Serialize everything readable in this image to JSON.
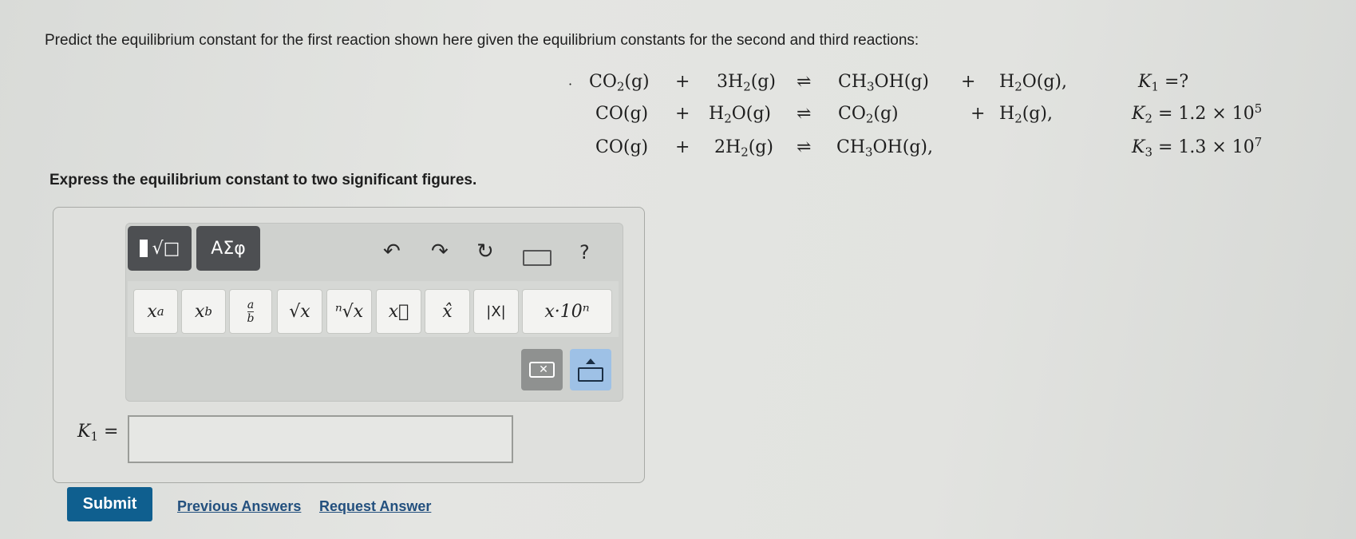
{
  "question": {
    "prompt": "Predict the equilibrium constant for the first reaction shown here given the equilibrium constants for the second and third reactions:",
    "instruction": "Express the equilibrium constant to two significant figures."
  },
  "equations": [
    {
      "reactant1": "CO₂(g)",
      "plus1": "+",
      "reactant2": "3H₂(g)",
      "arrow": "⇌",
      "product1": "CH₃OH(g)",
      "plus2": "+",
      "product2": "H₂O(g),",
      "k_label": "K₁",
      "k_value": "=?"
    },
    {
      "reactant1": "CO(g)",
      "plus1": "+",
      "reactant2": "H₂O(g)",
      "arrow": "⇌",
      "product1": "CO₂(g)",
      "plus2": "+",
      "product2": "H₂(g),",
      "k_label": "K₂",
      "k_value": "= 1.2 × 10⁵"
    },
    {
      "reactant1": "CO(g)",
      "plus1": "+",
      "reactant2": "2H₂(g)",
      "arrow": "⇌",
      "product1": "CH₃OH(g),",
      "plus2": "",
      "product2": "",
      "k_label": "K₃",
      "k_value": "= 1.3 × 10⁷"
    }
  ],
  "toolbar": {
    "template_btn": "√□",
    "greek_btn": "ΑΣφ",
    "help": "?",
    "symbols": {
      "superscript": "xᵃ",
      "subscript": "x_b",
      "fraction_num": "a",
      "fraction_den": "b",
      "sqrt": "√x",
      "nthroot": "ⁿ√x",
      "vector": "x⃗",
      "unit_vector": "x̂",
      "abs": "|X|",
      "sci": "x·10ⁿ"
    }
  },
  "answer": {
    "label": "K₁ =",
    "value": ""
  },
  "actions": {
    "submit": "Submit",
    "previous": "Previous Answers",
    "request": "Request Answer"
  }
}
